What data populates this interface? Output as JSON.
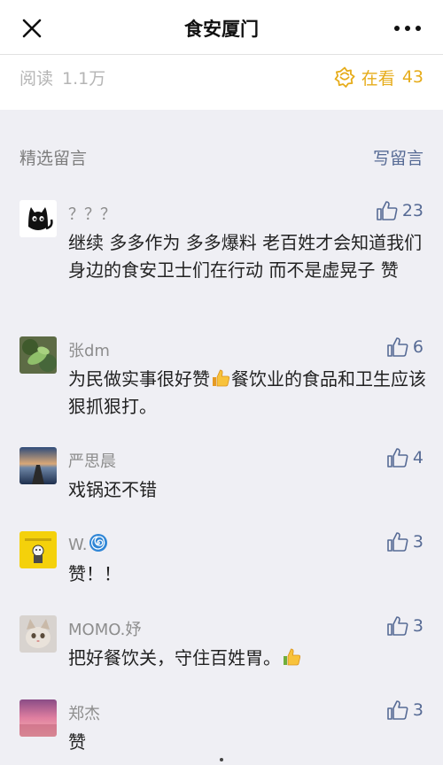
{
  "navbar": {
    "title": "食安厦门"
  },
  "stats": {
    "read_label": "阅读",
    "read_count": "1.1万",
    "looking_label": "在看",
    "looking_count": "43"
  },
  "section": {
    "title": "精选留言",
    "write_label": "写留言"
  },
  "colors": {
    "accent_yellow": "#e6ac1a",
    "link_blue": "#576b95",
    "background": "#efeff4"
  },
  "comments": [
    {
      "name": "？？？",
      "likes": "23",
      "text": "继续 多多作为 多多爆料 老百姓才会知道我们身边的食安卫士们在行动 而不是虚晃子 赞",
      "avatar": "black-cat-avatar"
    },
    {
      "name": "张dm",
      "likes": "6",
      "text_before": "为民做实事很好赞",
      "emoji": "thumbs-up-icon",
      "text_after": "餐饮业的食品和卫生应该狠抓狠打。",
      "avatar": "green-leaf-avatar"
    },
    {
      "name": "严思晨",
      "likes": "4",
      "text": "戏锅还不错",
      "avatar": "sunset-pier-avatar"
    },
    {
      "name": "W.",
      "name_icon": "spiral-icon",
      "likes": "3",
      "text": "赞！！",
      "avatar": "yellow-character-avatar"
    },
    {
      "name": "MOMO.妤",
      "likes": "3",
      "text_before": "把好餐饮关，守住百姓胃。",
      "emoji": "thumbs-up-icon",
      "avatar": "kitten-avatar"
    },
    {
      "name": "郑杰",
      "likes": "3",
      "text": "赞",
      "avatar": "pink-sky-avatar"
    }
  ]
}
